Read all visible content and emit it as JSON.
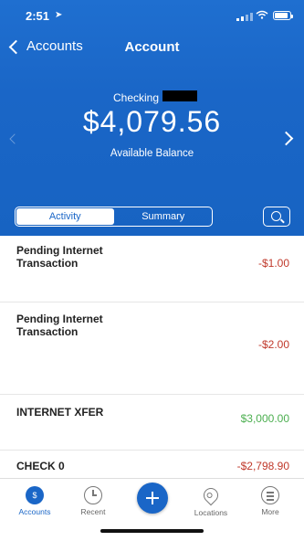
{
  "status": {
    "time": "2:51"
  },
  "nav": {
    "back_label": "Accounts",
    "title": "Account"
  },
  "account": {
    "type": "Checking",
    "balance": "$4,079.56",
    "balance_label": "Available Balance"
  },
  "segments": {
    "activity": "Activity",
    "summary": "Summary",
    "selected": "Activity"
  },
  "transactions": [
    {
      "name": "Pending Internet Transaction",
      "amount": "-$1.00"
    },
    {
      "name": "Pending Internet Transaction",
      "amount": "-$2.00"
    },
    {
      "name": "INTERNET XFER",
      "amount": "$3,000.00"
    },
    {
      "name": "CHECK 0",
      "amount": "-$2,798.90"
    }
  ],
  "tabs": {
    "accounts": "Accounts",
    "recent": "Recent",
    "locations": "Locations",
    "more": "More"
  },
  "colors": {
    "brand_blue": "#1a66c7",
    "negative": "#c0392b",
    "positive": "#4caf50"
  }
}
